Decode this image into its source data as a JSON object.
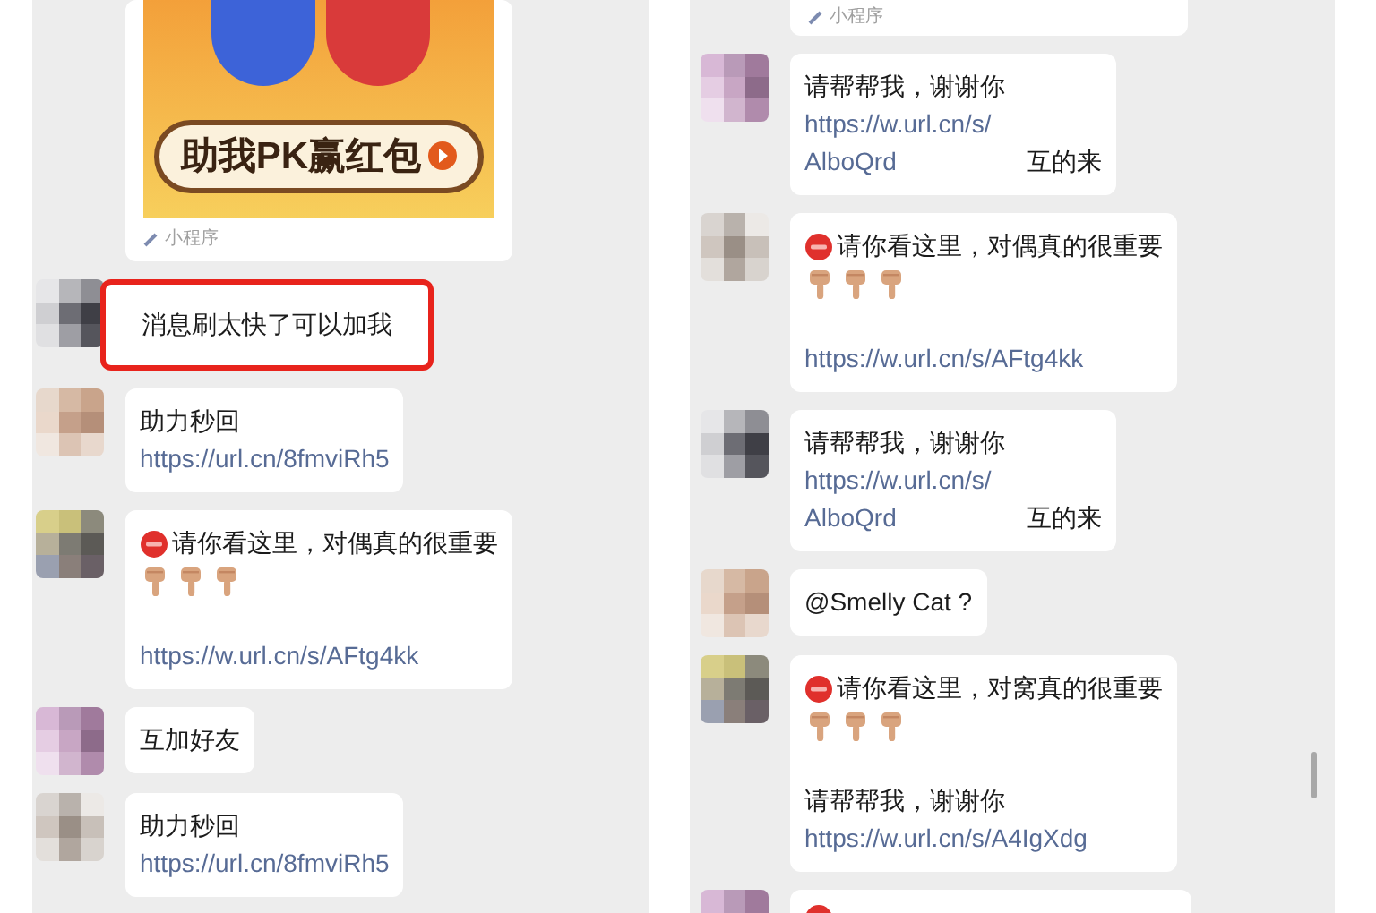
{
  "panels": [
    {
      "messages": [
        {
          "kind": "miniapp",
          "banner": "助我PK赢红包",
          "label": "小程序"
        },
        {
          "kind": "bubble",
          "highlighted": true,
          "parts": [
            {
              "kind": "text",
              "text": "消息刷太快了可以加我"
            }
          ]
        },
        {
          "kind": "bubble",
          "highlighted": false,
          "parts": [
            {
              "kind": "text",
              "text": "助力秒回"
            },
            {
              "kind": "link",
              "text": "https://url.cn/8fmviRh5"
            }
          ]
        },
        {
          "kind": "bubble",
          "highlighted": false,
          "parts": [
            {
              "kind": "alert",
              "text": "请你看这里，对偶真的很重要"
            },
            {
              "kind": "hands"
            },
            {
              "kind": "link",
              "text": "https://w.url.cn/s/AFtg4kk"
            }
          ]
        },
        {
          "kind": "bubble",
          "highlighted": false,
          "parts": [
            {
              "kind": "text",
              "text": "互加好友"
            }
          ]
        },
        {
          "kind": "bubble",
          "highlighted": false,
          "parts": [
            {
              "kind": "text",
              "text": "助力秒回"
            },
            {
              "kind": "link",
              "text": "https://url.cn/8fmviRh5"
            }
          ]
        }
      ]
    },
    {
      "messages": [
        {
          "kind": "miniapp_cut",
          "label": "小程序"
        },
        {
          "kind": "bubble",
          "highlighted": false,
          "parts": [
            {
              "kind": "text",
              "text": "请帮帮我，谢谢你"
            },
            {
              "kind": "link_note",
              "text": "https://w.url.cn/s/AlboQrd",
              "note": "互的来"
            }
          ]
        },
        {
          "kind": "bubble",
          "highlighted": false,
          "parts": [
            {
              "kind": "alert",
              "text": "请你看这里，对偶真的很重要"
            },
            {
              "kind": "hands"
            },
            {
              "kind": "link",
              "text": "https://w.url.cn/s/AFtg4kk"
            }
          ]
        },
        {
          "kind": "bubble",
          "highlighted": false,
          "parts": [
            {
              "kind": "text",
              "text": "请帮帮我，谢谢你"
            },
            {
              "kind": "link_note",
              "text": "https://w.url.cn/s/AlboQrd",
              "note": "互的来"
            }
          ]
        },
        {
          "kind": "bubble",
          "highlighted": false,
          "parts": [
            {
              "kind": "text",
              "text": "@Smelly Cat ?"
            }
          ]
        },
        {
          "kind": "bubble",
          "highlighted": false,
          "parts": [
            {
              "kind": "alert",
              "text": "请你看这里，对窝真的很重要"
            },
            {
              "kind": "hands"
            },
            {
              "kind": "text",
              "text": "请帮帮我，谢谢你"
            },
            {
              "kind": "link",
              "text": "https://w.url.cn/s/A4IgXdg"
            }
          ]
        },
        {
          "kind": "bubble_cut"
        }
      ]
    }
  ]
}
